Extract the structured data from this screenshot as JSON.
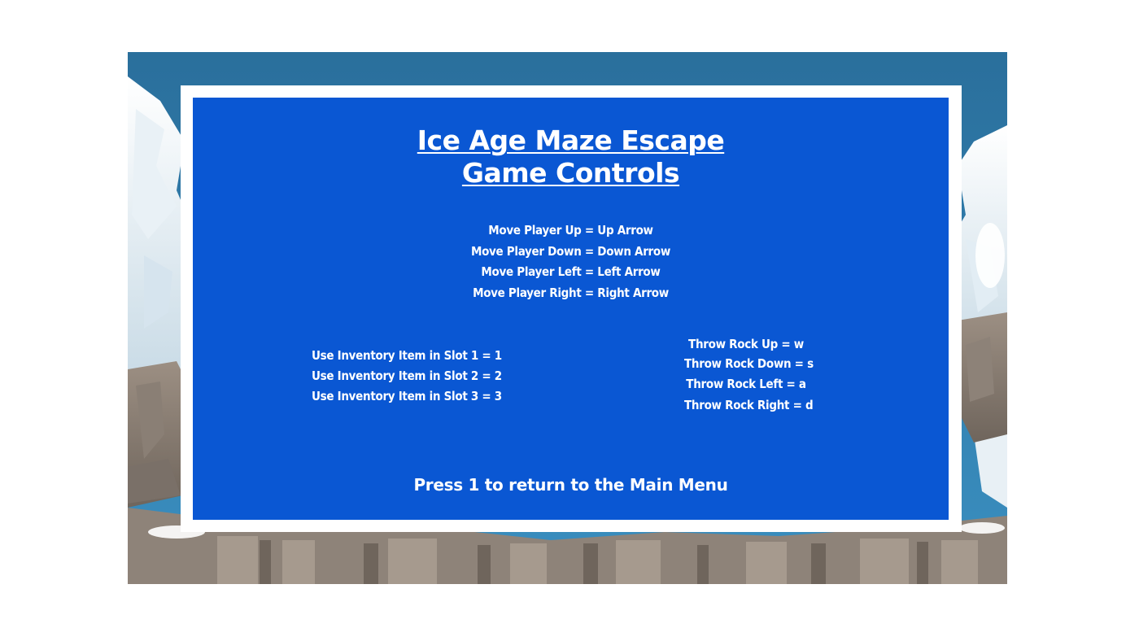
{
  "game": {
    "title_line1": "Ice Age Maze Escape",
    "title_line2": "Game Controls",
    "movement_controls": [
      "Move Player Up = Up Arrow",
      "Move Player Down = Down Arrow",
      "Move Player Left = Left Arrow",
      "Move Player Right = Right Arrow"
    ],
    "inventory_controls": [
      "Use Inventory Item in Slot 1 = 1",
      "Use Inventory Item in Slot 2 = 2",
      "Use Inventory Item in Slot 3 = 3"
    ],
    "throw_controls": [
      "Throw Rock Up = w",
      "Throw Rock Down = s",
      "Throw Rock Left = a",
      "Throw Rock Right = d"
    ],
    "footer": "Press 1 to return to the Main Menu"
  },
  "colors": {
    "panel": "#0a57d3",
    "sky": "#2f78a6",
    "border": "#ffffff",
    "text": "#ffffff"
  }
}
